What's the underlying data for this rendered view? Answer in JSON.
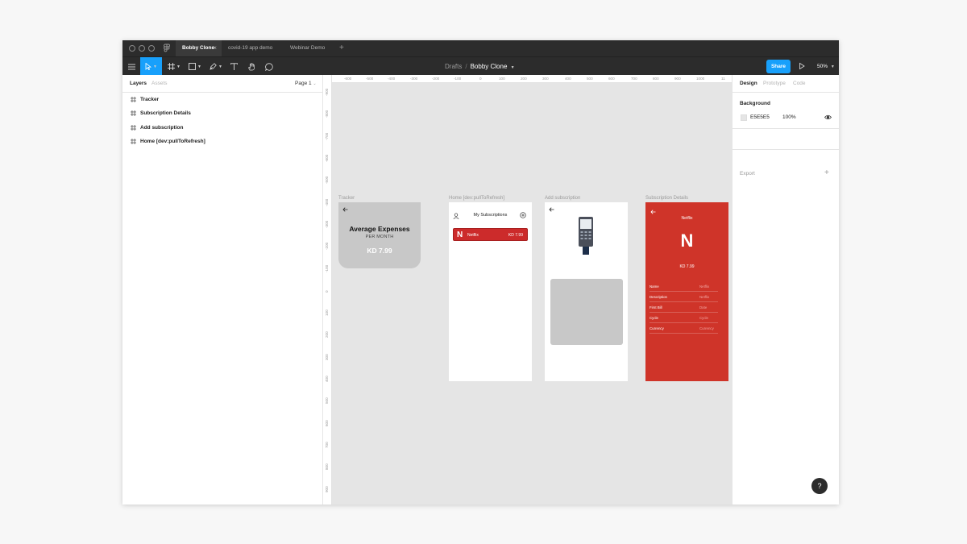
{
  "tabs": [
    {
      "label": "Bobby Clone",
      "active": true
    },
    {
      "label": "covid-19 app demo",
      "active": false
    },
    {
      "label": "Webinar Demo",
      "active": false
    }
  ],
  "tab_add": "+",
  "tab_close": "×",
  "breadcrumb": {
    "folder": "Drafts",
    "separator": "/",
    "file": "Bobby Clone"
  },
  "share_label": "Share",
  "zoom_label": "50%",
  "left_panel": {
    "tab_layers": "Layers",
    "tab_assets": "Assets",
    "page_selector": "Page 1",
    "layers": [
      "Tracker",
      "Subscription Details",
      "Add subscription",
      "Home [dev:pullToRefresh]"
    ]
  },
  "ruler_top": [
    "-600",
    "-500",
    "-400",
    "-300",
    "-200",
    "-100",
    "0",
    "100",
    "200",
    "300",
    "400",
    "500",
    "600",
    "700",
    "800",
    "900",
    "1000",
    "11"
  ],
  "ruler_left": [
    "-900",
    "-800",
    "-700",
    "-600",
    "-500",
    "-400",
    "-300",
    "-200",
    "-100",
    "0",
    "100",
    "200",
    "300",
    "400",
    "500",
    "600",
    "700",
    "800",
    "900"
  ],
  "frames": {
    "tracker": {
      "label": "Tracker",
      "title": "Average Expenses",
      "subtitle": "PER MONTH",
      "amount": "KD 7.99"
    },
    "home": {
      "label": "Home [dev:pullToRefresh]",
      "title": "My Subscriptions",
      "item_logo": "N",
      "item_name": "Netflix",
      "item_price": "KD 7.99"
    },
    "add": {
      "label": "Add subscription"
    },
    "details": {
      "label": "Subscription Details",
      "title": "Netflix",
      "logo": "N",
      "price": "KD 7.99",
      "rows": [
        {
          "key": "Name",
          "value": "Netflix"
        },
        {
          "key": "Description",
          "value": "Netflix"
        },
        {
          "key": "First Bill",
          "value": "Date"
        },
        {
          "key": "Cycle",
          "value": "Cycle"
        },
        {
          "key": "Currency",
          "value": "Currency"
        }
      ]
    }
  },
  "right_panel": {
    "tabs": [
      "Design",
      "Prototype",
      "Code"
    ],
    "background_title": "Background",
    "background_hex": "E5E5E5",
    "background_opacity": "100%",
    "export_label": "Export",
    "export_add": "+"
  },
  "help_label": "?",
  "colors": {
    "accent": "#18a0fb",
    "netflix_red": "#cf3429",
    "canvas": "#e5e5e5",
    "chrome": "#2c2c2c"
  }
}
